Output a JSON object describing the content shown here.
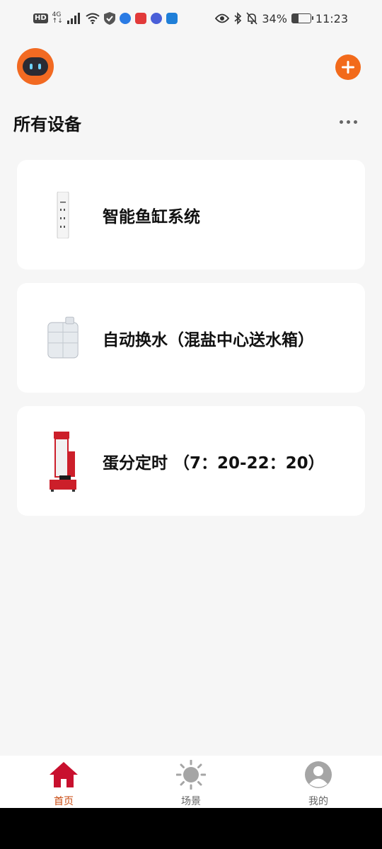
{
  "status_bar": {
    "hd": "HD",
    "network": "4G",
    "network_sub": "↑↓",
    "battery_level": 34,
    "battery": "34%",
    "time": "11:23",
    "app_colors": [
      "#2a7be4",
      "#e23a3a",
      "#4a5fd8",
      "#1f7fd8"
    ]
  },
  "header": {
    "title": "所有设备",
    "accent_color": "#f26a1b"
  },
  "devices": [
    {
      "name": "智能鱼缸系统",
      "icon": "power-strip-icon"
    },
    {
      "name": "自动换水（混盐中心送水箱）",
      "icon": "water-tank-icon"
    },
    {
      "name": "蛋分定时 （7：20-22：20）",
      "icon": "protein-skimmer-icon"
    }
  ],
  "nav": {
    "items": [
      {
        "label": "首页",
        "icon": "home-icon",
        "active": true
      },
      {
        "label": "场景",
        "icon": "sun-icon",
        "active": false
      },
      {
        "label": "我的",
        "icon": "user-icon",
        "active": false
      }
    ],
    "active_color": "#c94a10"
  }
}
